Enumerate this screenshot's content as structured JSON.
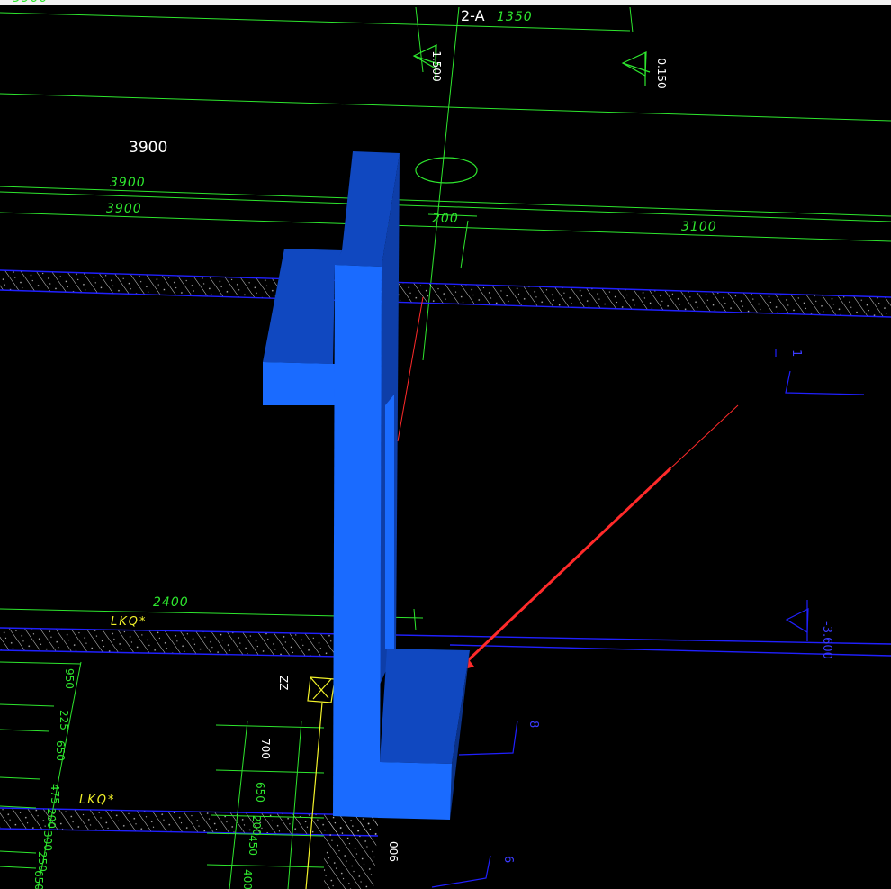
{
  "top_labels": {
    "grid_ref": "2-A",
    "dim_1350": "1350",
    "elev_left": "-1.500",
    "elev_right": "-0.150",
    "dim_top_left": "3900"
  },
  "mid_labels": {
    "dim_white": "3900",
    "dim_a": "3900",
    "dim_b": "3900",
    "dim_200": "200",
    "dim_3100": "3100",
    "dim_2400": "2400"
  },
  "annotations": {
    "lkq_1": "LKQ*",
    "lkq_2": "LKQ*",
    "zz": "ZZ",
    "elev_mid_right": "-3.600",
    "right_mark_1": "1",
    "right_mark_8": "8",
    "right_mark_6": "6",
    "bottom_label": "006"
  },
  "left_dims": [
    "950",
    "225",
    "650",
    "475",
    "200",
    "300",
    "250",
    "650"
  ],
  "center_dims": [
    "700",
    "650",
    "200",
    "450",
    "400"
  ],
  "colors": {
    "background": "#000000",
    "grid_green": "#2ee62e",
    "wall_blue": "#1a5cff",
    "wall_dark": "#0e3ea8",
    "boundary_blue": "#2020ff",
    "arrow_red": "#ff2a2a",
    "column_yellow": "#f3f32a"
  }
}
